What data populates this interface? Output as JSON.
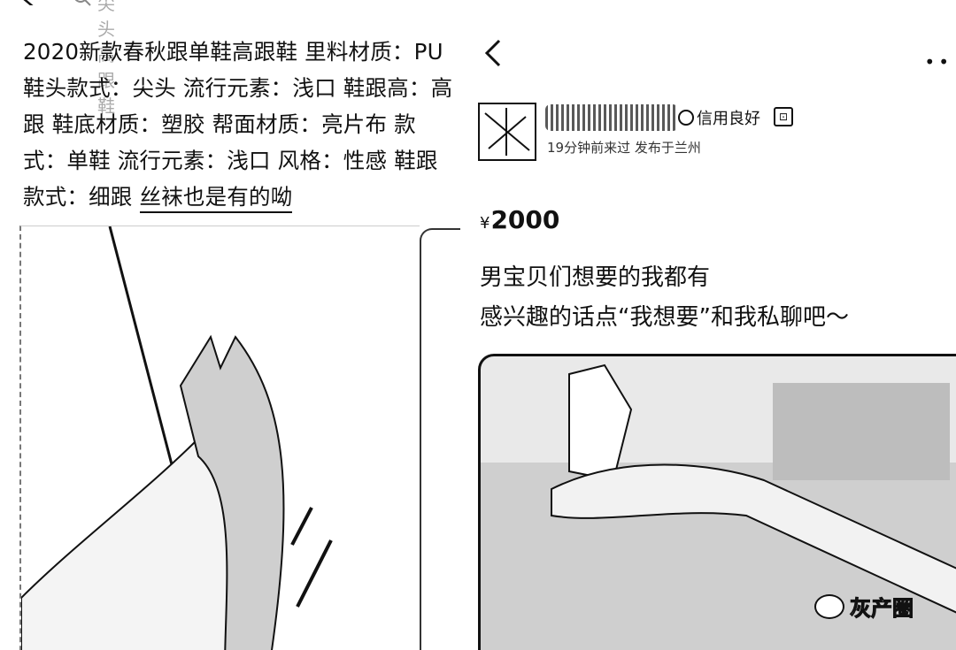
{
  "left": {
    "search_text": "尖头高跟鞋",
    "description": "2020新款春秋跟单鞋高跟鞋 里料材质：PU 鞋头款式：尖头 流行元素：浅口 鞋跟高：高跟 鞋底材质：塑胶 帮面材质：亮片布 款式：单鞋 流行元素：浅口 风格：性感 鞋跟款式：细跟",
    "highlight": "丝袜也是有的呦"
  },
  "right": {
    "credit": "信用良好",
    "meta": "19分钟前来过 发布于兰州",
    "price_symbol": "¥",
    "price": "2000",
    "post_line1": "男宝贝们想要的我都有",
    "post_line2": "感兴趣的话点“我想要”和我私聊吧～",
    "watermark": "灰产圈"
  }
}
